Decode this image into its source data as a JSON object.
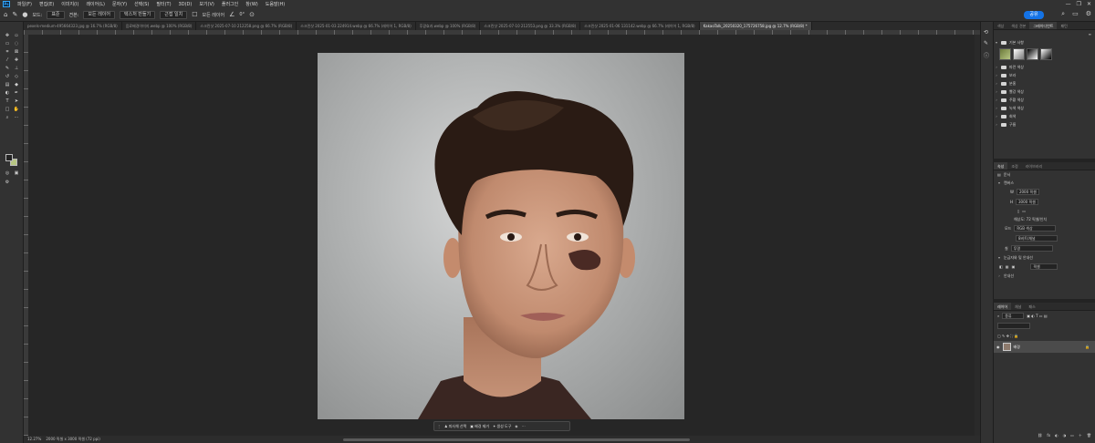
{
  "menubar": {
    "items": [
      "파일(F)",
      "편집(E)",
      "이미지(I)",
      "레이어(L)",
      "문자(Y)",
      "선택(S)",
      "필터(T)",
      "3D(D)",
      "보기(V)",
      "플러그인",
      "창(W)",
      "도움말(H)"
    ],
    "minimize": "—",
    "maximize": "❐",
    "close": "✕"
  },
  "options_bar": {
    "mode_label": "모드:",
    "mode_value": "표준",
    "sample_label": "견본:",
    "sample_value": "모든 레이어",
    "align_label": "텍스처 만들기",
    "type_value": "근접 일치",
    "angle_value": "0°",
    "share_button": "공유"
  },
  "doc_tabs": [
    "pexels-medium-495664323.jpg @ 16.7% (RGB/8)",
    "음료배경이미지.webp @ 100% (RGB/8)",
    "스크린샷 2025-07-10 212258.png @ 66.7% (RGB/8)",
    "스크린샷 2025-01-03 224914.webp @ 66.7% (레이어 1, RGB/8)",
    "후광효과.webp @ 100% (RGB/8)",
    "스크린샷 2025-07-10 212553.png @ 33.3% (RGB/8)",
    "스크린샷 2025-01-06 131142.webp @ 66.7% (레이어 1, RGB/8)",
    "KakaoTalk_20250320_175726758.jpg @ 12.7% (RGB/8) *"
  ],
  "active_tab_index": 7,
  "context_bar": {
    "select_subject": "피사체 선택",
    "remove_bg": "배경 제거",
    "generative": "생성 도구"
  },
  "status": {
    "zoom": "12.27%",
    "size": "2000 픽셀 x 3000 픽셀 (72 ppi)"
  },
  "gradient_panel": {
    "tabs": [
      "색상",
      "색상 견본",
      "그레이디언트",
      "패턴"
    ],
    "active_tab": 2,
    "folders": [
      "기본 사항",
      "파란 색상",
      "보라",
      "분홍",
      "빨강 색상",
      "주황 색상",
      "녹색 색상",
      "회색",
      "구름"
    ]
  },
  "properties_panel": {
    "tabs": [
      "속성",
      "조정",
      "라이브러리"
    ],
    "doc_label": "문서",
    "canvas_label": "캔버스",
    "width_value": "2000 픽셀",
    "height_value": "3000 픽셀",
    "resolution_label": "해상도: 72 픽셀/인치",
    "mode_label": "모드",
    "mode_value": "RGB 색상",
    "depth_value": "8비트/채널",
    "fill_label": "칠",
    "fill_value": "투명",
    "guides_label": "눈금자와 및 안내선",
    "guides_unit": "픽셀",
    "guides_sub": "안내선"
  },
  "layers_panel": {
    "tabs": [
      "레이어",
      "채널",
      "패스"
    ],
    "search_placeholder": "종류",
    "layer_name": "배경"
  },
  "colors": {
    "accent": "#1473e6",
    "background_swatch": "#b8c784"
  }
}
